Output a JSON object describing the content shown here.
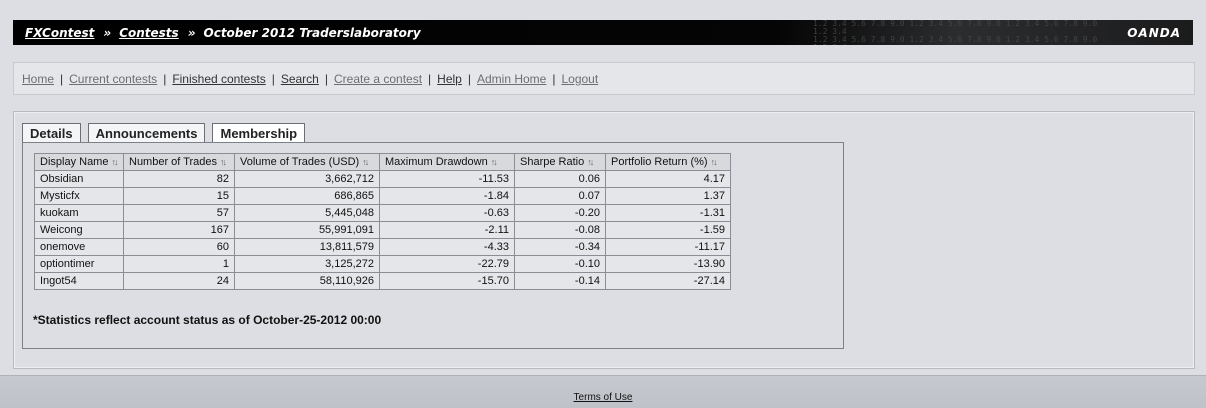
{
  "header": {
    "crumbs": [
      "FXContest",
      "Contests",
      "October 2012 Traderslaboratory"
    ],
    "separator": "»",
    "brand": "OANDA"
  },
  "nav": {
    "items": [
      {
        "label": "Home",
        "dim": true
      },
      {
        "label": "Current contests",
        "dim": true
      },
      {
        "label": "Finished contests",
        "dim": false
      },
      {
        "label": "Search",
        "dim": false
      },
      {
        "label": "Create a contest",
        "dim": true
      },
      {
        "label": "Help",
        "dim": false
      },
      {
        "label": "Admin Home",
        "dim": true
      },
      {
        "label": "Logout",
        "dim": true
      }
    ],
    "divider": "|"
  },
  "tabs": [
    {
      "label": "Details",
      "active": false
    },
    {
      "label": "Announcements",
      "active": false
    },
    {
      "label": "Membership",
      "active": true
    }
  ],
  "table": {
    "columns": [
      "Display Name",
      "Number of Trades",
      "Volume of Trades (USD)",
      "Maximum Drawdown",
      "Sharpe Ratio",
      "Portfolio Return (%)"
    ],
    "column_widths": [
      90,
      112,
      146,
      136,
      92,
      126
    ],
    "rows": [
      [
        "Obsidian",
        "82",
        "3,662,712",
        "-11.53",
        "0.06",
        "4.17"
      ],
      [
        "Mysticfx",
        "15",
        "686,865",
        "-1.84",
        "0.07",
        "1.37"
      ],
      [
        "kuokam",
        "57",
        "5,445,048",
        "-0.63",
        "-0.20",
        "-1.31"
      ],
      [
        "Weicong",
        "167",
        "55,991,091",
        "-2.11",
        "-0.08",
        "-1.59"
      ],
      [
        "onemove",
        "60",
        "13,811,579",
        "-4.33",
        "-0.34",
        "-11.17"
      ],
      [
        "optiontimer",
        "1",
        "3,125,272",
        "-22.79",
        "-0.10",
        "-13.90"
      ],
      [
        "Ingot54",
        "24",
        "58,110,926",
        "-15.70",
        "-0.14",
        "-27.14"
      ]
    ]
  },
  "note": "*Statistics reflect account status as of October-25-2012 00:00",
  "footer": {
    "terms": "Terms of Use"
  },
  "icons": {
    "sort": "sort-arrows-icon"
  },
  "colors": {
    "header_bg": "#000000",
    "page_bg": "#dcdee4",
    "table_header_bg": "#d7d9dd"
  }
}
